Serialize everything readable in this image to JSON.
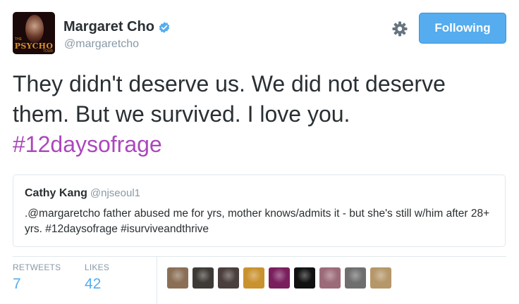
{
  "author": {
    "name": "Margaret Cho",
    "handle": "@margaretcho",
    "avatar_text": "PSYCHO",
    "avatar_small_top": "THE",
    "avatar_small_bottom": "TOUR"
  },
  "follow_button": {
    "label": "Following"
  },
  "tweet": {
    "text": "They didn't deserve us. We did not deserve them. But we survived. I love you.",
    "hashtag": "#12daysofrage"
  },
  "quoted_tweet": {
    "name": "Cathy Kang",
    "handle": "@njseoul1",
    "text": ".@margaretcho father abused me for yrs, mother knows/admits it - but she's still w/him after 28+ yrs. #12daysofrage #isurviveandthrive"
  },
  "stats": {
    "retweets_label": "RETWEETS",
    "retweets_value": "7",
    "likes_label": "LIKES",
    "likes_value": "42"
  },
  "likers": [
    {
      "icon": "liker-avatar-1",
      "color": "#8a6f56"
    },
    {
      "icon": "liker-avatar-2",
      "color": "#3d3a35"
    },
    {
      "icon": "liker-avatar-3",
      "color": "#4a3f3c"
    },
    {
      "icon": "liker-avatar-4",
      "color": "#c9922f"
    },
    {
      "icon": "liker-avatar-5",
      "color": "#7a1f5e"
    },
    {
      "icon": "liker-avatar-6",
      "color": "#111111"
    },
    {
      "icon": "liker-avatar-7",
      "color": "#9c6b7a"
    },
    {
      "icon": "liker-avatar-8",
      "color": "#6e6e6e"
    },
    {
      "icon": "liker-avatar-9",
      "color": "#b5976a"
    }
  ],
  "colors": {
    "accent": "#55acee",
    "hashtag": "#ab47bc",
    "muted": "#8899a6",
    "text": "#292f33"
  }
}
